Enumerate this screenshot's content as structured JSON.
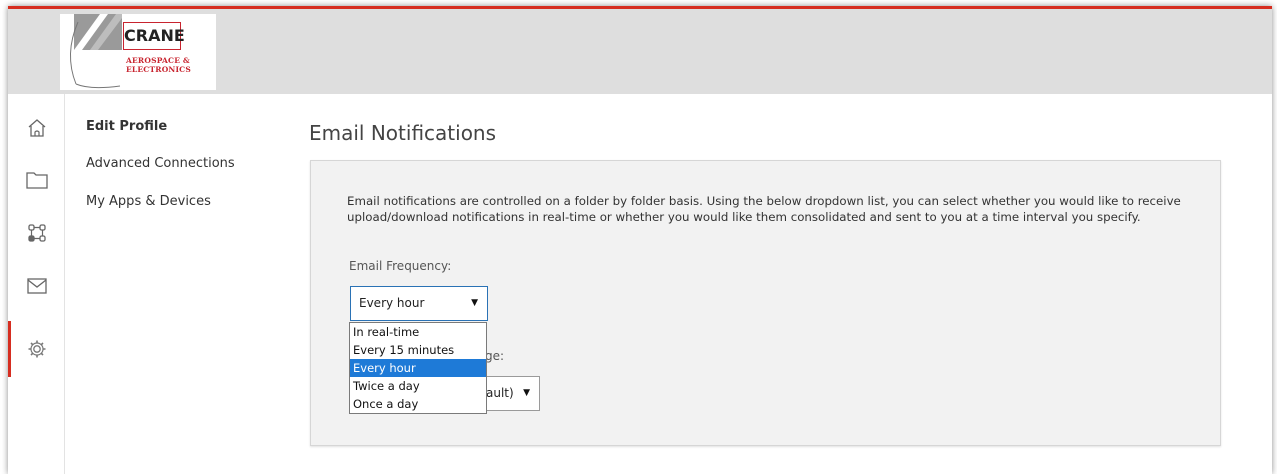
{
  "logo": {
    "name": "CRANE",
    "subline1": "AEROSPACE &",
    "subline2": "ELECTRONICS"
  },
  "iconbar": [
    {
      "icon": "home-icon"
    },
    {
      "icon": "folder-icon"
    },
    {
      "icon": "workflow-icon"
    },
    {
      "icon": "mail-icon"
    },
    {
      "icon": "gear-icon",
      "active": true
    }
  ],
  "subnav": {
    "items": [
      {
        "label": "Edit Profile",
        "active": true
      },
      {
        "label": "Advanced Connections"
      },
      {
        "label": "My Apps & Devices"
      }
    ]
  },
  "page": {
    "title": "Email Notifications",
    "description": "Email notifications are controlled on a folder by folder basis. Using the below dropdown list, you can select whether you would like to receive upload/download notifications in real-time or whether you would like them consolidated and sent to you at a time interval you specify.",
    "frequency_label": "Email Frequency:",
    "frequency_value": "Every hour",
    "language_label_partial": "ge:",
    "language_value_partial": "ault)"
  },
  "dropdown": {
    "options": [
      {
        "label": "In real-time"
      },
      {
        "label": "Every 15 minutes"
      },
      {
        "label": "Every hour",
        "selected": true
      },
      {
        "label": "Twice a day"
      },
      {
        "label": "Once a day"
      }
    ]
  },
  "colors": {
    "accent": "#d62d20",
    "selection": "#1e7ad7",
    "header_bg": "#dedede",
    "panel_bg": "#f2f2f2"
  }
}
